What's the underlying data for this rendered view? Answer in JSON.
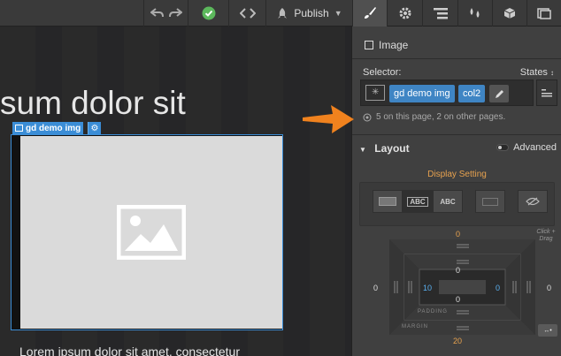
{
  "toolbar": {
    "undo_icon": "undo-icon",
    "redo_icon": "redo-icon",
    "check_icon": "check-circle-icon",
    "code_icon": "code-icon",
    "publish_label": "Publish",
    "tabs": [
      "brush-icon",
      "gear-icon",
      "navigator-icon",
      "drops-icon",
      "box-icon",
      "assets-icon"
    ]
  },
  "canvas": {
    "heading": "sum dolor sit",
    "element_label": "gd demo img",
    "body_text": "Lorem ipsum dolor sit amet, consectetur"
  },
  "panel": {
    "element_type": "Image",
    "selector_label": "Selector:",
    "states_label": "States",
    "chips": [
      "gd demo img",
      "col2"
    ],
    "usage_text": "5 on this page, 2 on other pages.",
    "layout_label": "Layout",
    "advanced_label": "Advanced",
    "display_setting_label": "Display Setting",
    "display_options": [
      "block",
      "inline-block",
      "inline",
      "flex",
      "none"
    ],
    "inline_block_text": "ABC",
    "inline_text": "ABC",
    "click_drag_label": "Click + Drag",
    "box_model": {
      "margin_top": "0",
      "margin_left": "0",
      "margin_right": "0",
      "margin_bottom": "20",
      "padding_top": "0",
      "padding_left": "10",
      "padding_right": "0",
      "padding_bottom": "0",
      "padding_label": "PADDING",
      "margin_label": "MARGIN"
    },
    "colors": {
      "accent": "#3f85c4",
      "orange": "#e7a24f",
      "selection": "#3b8dd6"
    }
  }
}
